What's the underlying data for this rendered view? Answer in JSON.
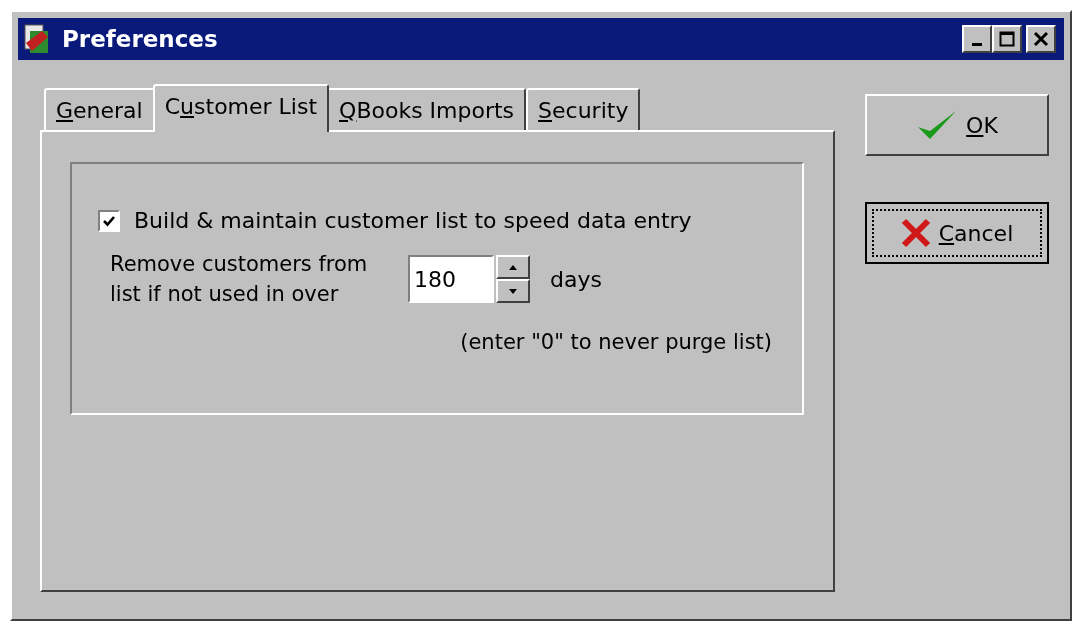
{
  "window": {
    "title": "Preferences"
  },
  "title_buttons": [
    {
      "kind": "minimize"
    },
    {
      "kind": "maximize"
    },
    {
      "kind": "close"
    }
  ],
  "tabs": [
    {
      "label_parts": {
        "key": "G",
        "after": "eneral"
      },
      "selected": false
    },
    {
      "label_parts": {
        "before": "C",
        "key": "u",
        "after": "stomer List"
      },
      "selected": true
    },
    {
      "label_parts": {
        "key": "Q",
        "after": "Books Imports"
      },
      "selected": false
    },
    {
      "label_parts": {
        "key": "S",
        "after": "ecurity"
      },
      "selected": false
    }
  ],
  "build_list": {
    "label": "Build & maintain customer list to speed data entry",
    "checked": true
  },
  "purge": {
    "label": "Remove customers from list if not used in over",
    "value": "180",
    "unit": "days",
    "hint": "(enter \"0\" to never purge list)"
  },
  "buttons": [
    {
      "kind": "ok",
      "label_parts": {
        "key": "O",
        "after": "K"
      },
      "focused": false
    },
    {
      "kind": "cancel",
      "label_parts": {
        "key": "C",
        "after": "ancel"
      },
      "focused": true
    }
  ]
}
